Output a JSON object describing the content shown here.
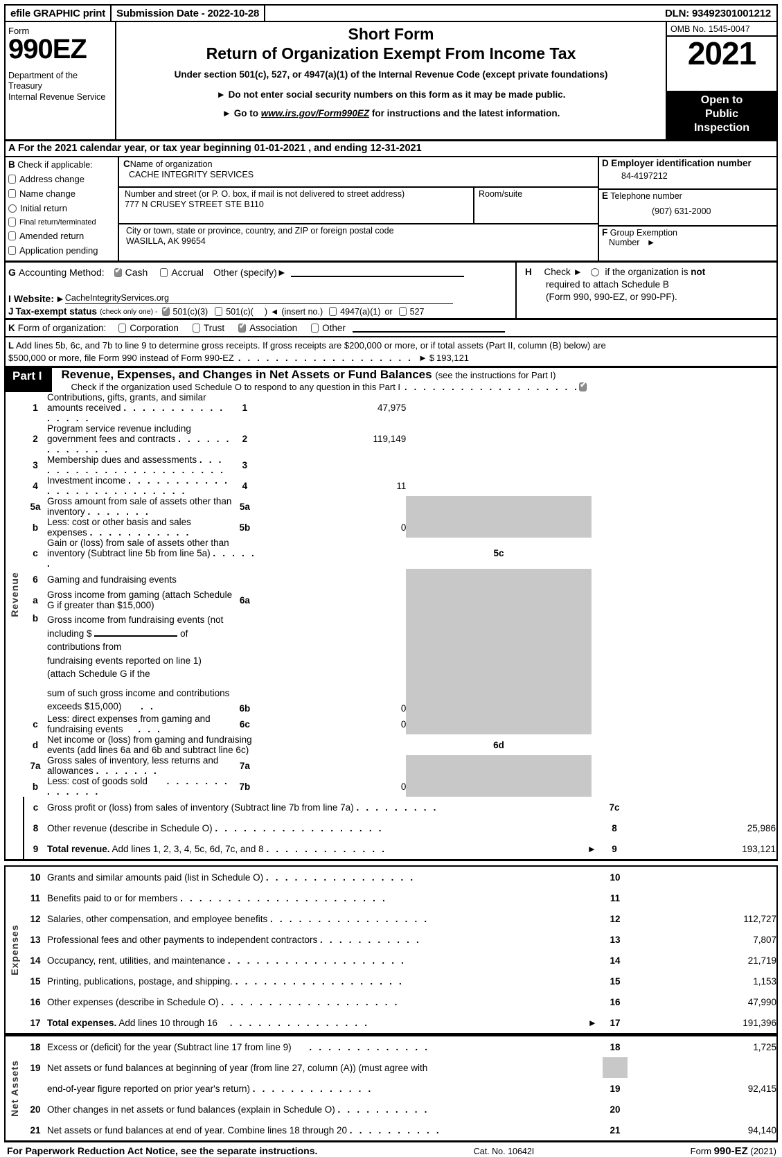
{
  "efile": {
    "print_label": "efile GRAPHIC print",
    "submission": "Submission Date - 2022-10-28",
    "dln": "DLN: 93492301001212"
  },
  "masthead": {
    "form_word": "Form",
    "form_number": "990EZ",
    "department": "Department of the Treasury\nInternal Revenue Service",
    "title_short": "Short Form",
    "title_main": "Return of Organization Exempt From Income Tax",
    "subtitle": "Under section 501(c), 527, or 4947(a)(1) of the Internal Revenue Code (except private foundations)",
    "bullet1": "Do not enter social security numbers on this form as it may be made public.",
    "bullet2_pre": "Go to",
    "bullet2_link": "www.irs.gov/Form990EZ",
    "bullet2_post": "for instructions and the latest information.",
    "omb": "OMB No. 1545-0047",
    "year": "2021",
    "open_to_public": "Open to\nPublic\nInspection"
  },
  "lineA": {
    "letter": "A",
    "text_pre": "For the 2021 calendar year, or tax year beginning",
    "begin_date": "01-01-2021",
    "text_mid": ", and ending",
    "end_date": "12-31-2021"
  },
  "sectionB": {
    "letter": "B",
    "header": "Check if applicable:",
    "items": [
      {
        "label": "Address change",
        "checked": false,
        "shape": "rect"
      },
      {
        "label": "Name change",
        "checked": false,
        "shape": "rect"
      },
      {
        "label": "Initial return",
        "checked": false,
        "shape": "round"
      },
      {
        "label": "Final return/terminated",
        "checked": false,
        "shape": "rect",
        "small": true
      },
      {
        "label": "Amended return",
        "checked": false,
        "shape": "rect"
      },
      {
        "label": "Application pending",
        "checked": false,
        "shape": "rect"
      }
    ]
  },
  "sectionC": {
    "letter": "C",
    "name_label": "Name of organization",
    "name_value": "CACHE INTEGRITY SERVICES",
    "street_label": "Number and street (or P. O. box, if mail is not delivered to street address)",
    "street_value": "777 N CRUSEY STREET STE B110",
    "room_label": "Room/suite",
    "room_value": "",
    "city_label": "City or town, state or province, country, and ZIP or foreign postal code",
    "city_value": "WASILLA, AK  99654"
  },
  "sectionD": {
    "letter": "D",
    "ein_label": "Employer identification number",
    "ein_value": "84-4197212",
    "letterE": "E",
    "phone_label": "Telephone number",
    "phone_value": "(907) 631-2000",
    "letterF": "F",
    "group_label": "Group Exemption",
    "group_label2": "Number",
    "group_value": ""
  },
  "sectionG": {
    "letter": "G",
    "label": "Accounting Method:",
    "cash": "Cash",
    "cash_checked": true,
    "accrual": "Accrual",
    "accrual_checked": false,
    "other": "Other (specify)",
    "other_value": ""
  },
  "sectionH": {
    "letter": "H",
    "line1_pre": "Check",
    "line1_post": "if the organization is",
    "line1_bold": "not",
    "line2": "required to attach Schedule B",
    "line3": "(Form 990, 990-EZ, or 990-PF)."
  },
  "sectionI": {
    "letter": "I",
    "label": "Website:",
    "value": "CacheIntegrityServices.org"
  },
  "sectionJ": {
    "letter": "J",
    "label": "Tax-exempt status",
    "note": "(check only one) -",
    "opt1": "501(c)(3)",
    "opt1_checked": true,
    "opt2": "501(c)(",
    "opt2_tail": ")",
    "opt2_checked": false,
    "insert_no": "(insert no.)",
    "opt3": "4947(a)(1)",
    "opt3_checked": false,
    "or": "or",
    "opt4": "527",
    "opt4_checked": false
  },
  "sectionK": {
    "letter": "K",
    "label": "Form of organization:",
    "options": [
      {
        "label": "Corporation",
        "checked": false
      },
      {
        "label": "Trust",
        "checked": false
      },
      {
        "label": "Association",
        "checked": true
      },
      {
        "label": "Other",
        "checked": false
      }
    ]
  },
  "sectionL": {
    "letter": "L",
    "line1": "Add lines 5b, 6c, and 7b to line 9 to determine gross receipts. If gross receipts are $200,000 or more, or if total assets (Part II, column (B) below) are",
    "line2": "$500,000 or more, file Form 990 instead of Form 990-EZ",
    "dots": ". . . . . . . . . . . . . . . . . . .",
    "amount_prefix": "$",
    "amount": "193,121"
  },
  "partI": {
    "label": "Part I",
    "title": "Revenue, Expenses, and Changes in Net Assets or Fund Balances",
    "note": "(see the instructions for Part I)",
    "schedule_o": "Check if the organization used Schedule O to respond to any question in this Part I",
    "schedule_o_dots": ". . . . . . . . . . . . . . . . . . .",
    "schedule_o_checked": true
  },
  "side_labels": {
    "revenue": "Revenue",
    "expenses": "Expenses",
    "net_assets": "Net Assets"
  },
  "revenue_rows": [
    {
      "no": "1",
      "desc": "Contributions, gifts, grants, and similar amounts received",
      "dots": ". . . . . . . . . . . . . . . .",
      "lineno": "1",
      "amount": "47,975"
    },
    {
      "no": "2",
      "desc": "Program service revenue including government fees and contracts",
      "dots": ". . . . . . . . . . . . .",
      "lineno": "2",
      "amount": "119,149"
    },
    {
      "no": "3",
      "desc": "Membership dues and assessments",
      "dots": ". . . . . . . . . . . . . . . . . . . . . .",
      "lineno": "3",
      "amount": ""
    },
    {
      "no": "4",
      "desc": "Investment income",
      "dots": ". . . . . . . . . . . . . . . . . . . . . . . . . .",
      "lineno": "4",
      "amount": "11"
    }
  ],
  "row5a": {
    "no": "5a",
    "desc": "Gross amount from sale of assets other than inventory",
    "dots": ". . . . . . .",
    "subno": "5a",
    "subval": ""
  },
  "row5b": {
    "no": "b",
    "desc": "Less: cost or other basis and sales expenses",
    "dots": ". . . . . . . . . . .",
    "subno": "5b",
    "subval": "0"
  },
  "row5c": {
    "no": "c",
    "desc": "Gain or (loss) from sale of assets other than inventory (Subtract line 5b from line 5a)",
    "dots": ". . . . . .",
    "lineno": "5c",
    "amount": ""
  },
  "row6": {
    "no": "6",
    "desc": "Gaming and fundraising events"
  },
  "row6a": {
    "no": "a",
    "desc": "Gross income from gaming (attach Schedule G if greater than $15,000)",
    "subno": "6a",
    "subval": ""
  },
  "row6b": {
    "no": "b",
    "line1_pre": "Gross income from fundraising events (not including $",
    "line1_post": "of contributions from",
    "line2": "fundraising events reported on line 1) (attach Schedule G if the",
    "line3": "sum of such gross income and contributions exceeds $15,000)",
    "dots": ". .",
    "subno": "6b",
    "subval": "0"
  },
  "row6c": {
    "no": "c",
    "desc": "Less: direct expenses from gaming and fundraising events",
    "dots": ". . .",
    "subno": "6c",
    "subval": "0"
  },
  "row6d": {
    "no": "d",
    "desc": "Net income or (loss) from gaming and fundraising events (add lines 6a and 6b and subtract line 6c)",
    "lineno": "6d",
    "amount": ""
  },
  "row7a": {
    "no": "7a",
    "desc": "Gross sales of inventory, less returns and allowances",
    "dots": ". . . . . . .",
    "subno": "7a",
    "subval": ""
  },
  "row7b": {
    "no": "b",
    "desc": "Less: cost of goods sold",
    "dots": ". . . . . . . . . . . . .",
    "subno": "7b",
    "subval": "0"
  },
  "row7c": {
    "no": "c",
    "desc": "Gross profit or (loss) from sales of inventory (Subtract line 7b from line 7a)",
    "dots": ". . . . . . . . .",
    "lineno": "7c",
    "amount": ""
  },
  "row8": {
    "no": "8",
    "desc": "Other revenue (describe in Schedule O)",
    "dots": ". . . . . . . . . . . . . . . . . .",
    "lineno": "8",
    "amount": "25,986"
  },
  "row9": {
    "no": "9",
    "desc_bold": "Total revenue.",
    "desc": "Add lines 1, 2, 3, 4, 5c, 6d, 7c, and 8",
    "dots": ". . . . . . . . . . . . .",
    "lineno": "9",
    "amount": "193,121"
  },
  "expense_rows": [
    {
      "no": "10",
      "desc": "Grants and similar amounts paid (list in Schedule O)",
      "dots": ". . . . . . . . . . . . . . . .",
      "lineno": "10",
      "amount": ""
    },
    {
      "no": "11",
      "desc": "Benefits paid to or for members",
      "dots": ". . . . . . . . . . . . . . . . . . . . . .",
      "lineno": "11",
      "amount": ""
    },
    {
      "no": "12",
      "desc": "Salaries, other compensation, and employee benefits",
      "dots": ". . . . . . . . . . . . . . . . .",
      "lineno": "12",
      "amount": "112,727"
    },
    {
      "no": "13",
      "desc": "Professional fees and other payments to independent contractors",
      "dots": ". . . . . . . . . . .",
      "lineno": "13",
      "amount": "7,807"
    },
    {
      "no": "14",
      "desc": "Occupancy, rent, utilities, and maintenance",
      "dots": ". . . . . . . . . . . . . . . . . . .",
      "lineno": "14",
      "amount": "21,719"
    },
    {
      "no": "15",
      "desc": "Printing, publications, postage, and shipping.",
      "dots": ". . . . . . . . . . . . . . . . . .",
      "lineno": "15",
      "amount": "1,153"
    },
    {
      "no": "16",
      "desc": "Other expenses (describe in Schedule O)",
      "dots": ". . . . . . . . . . . . . . . . . . .",
      "lineno": "16",
      "amount": "47,990"
    }
  ],
  "row17": {
    "no": "17",
    "desc_bold": "Total expenses.",
    "desc": "Add lines 10 through 16",
    "dots": ". . . . . . . . . . . . . . .",
    "lineno": "17",
    "amount": "191,396"
  },
  "row18": {
    "no": "18",
    "desc": "Excess or (deficit) for the year (Subtract line 17 from line 9)",
    "dots": ". . . . . . . . . . . . .",
    "lineno": "18",
    "amount": "1,725"
  },
  "row19": {
    "no": "19",
    "line1": "Net assets or fund balances at beginning of year (from line 27, column (A)) (must agree with",
    "line2": "end-of-year figure reported on prior year's return)",
    "dots": ". . . . . . . . . . . . .",
    "lineno": "19",
    "amount": "92,415"
  },
  "row20": {
    "no": "20",
    "desc": "Other changes in net assets or fund balances (explain in Schedule O)",
    "dots": ". . . . . . . . . .",
    "lineno": "20",
    "amount": ""
  },
  "row21": {
    "no": "21",
    "desc": "Net assets or fund balances at end of year. Combine lines 18 through 20",
    "dots": ". . . . . . . . . .",
    "lineno": "21",
    "amount": "94,140"
  },
  "footer": {
    "left": "For Paperwork Reduction Act Notice, see the separate instructions.",
    "center": "Cat. No. 10642I",
    "right_pre": "Form",
    "right_bold": "990-EZ",
    "right_post": "(2021)"
  }
}
